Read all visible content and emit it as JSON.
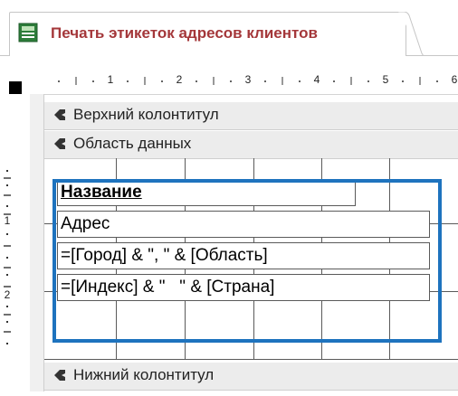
{
  "document_tab": {
    "title": "Печать этикеток адресов клиентов",
    "icon": "report-icon",
    "title_color": "#a4373a"
  },
  "ruler": {
    "horizontal_numbers": [
      "1",
      "2",
      "3",
      "4",
      "5",
      "6"
    ],
    "vertical_numbers": [
      "1",
      "2"
    ]
  },
  "sections": {
    "page_header": "Верхний колонтитул",
    "detail": "Область данных",
    "page_footer": "Нижний колонтитул"
  },
  "detail_controls": [
    {
      "text": "Название",
      "style": "bold-underline"
    },
    {
      "text": "Адрес",
      "style": "normal"
    },
    {
      "text": "=[Город] & \", \" & [Область]",
      "style": "normal"
    },
    {
      "text": "=[Индекс] & \"   \" & [Страна]",
      "style": "normal"
    }
  ],
  "colors": {
    "selection_frame": "#1e73be",
    "section_bar": "#ececec"
  }
}
